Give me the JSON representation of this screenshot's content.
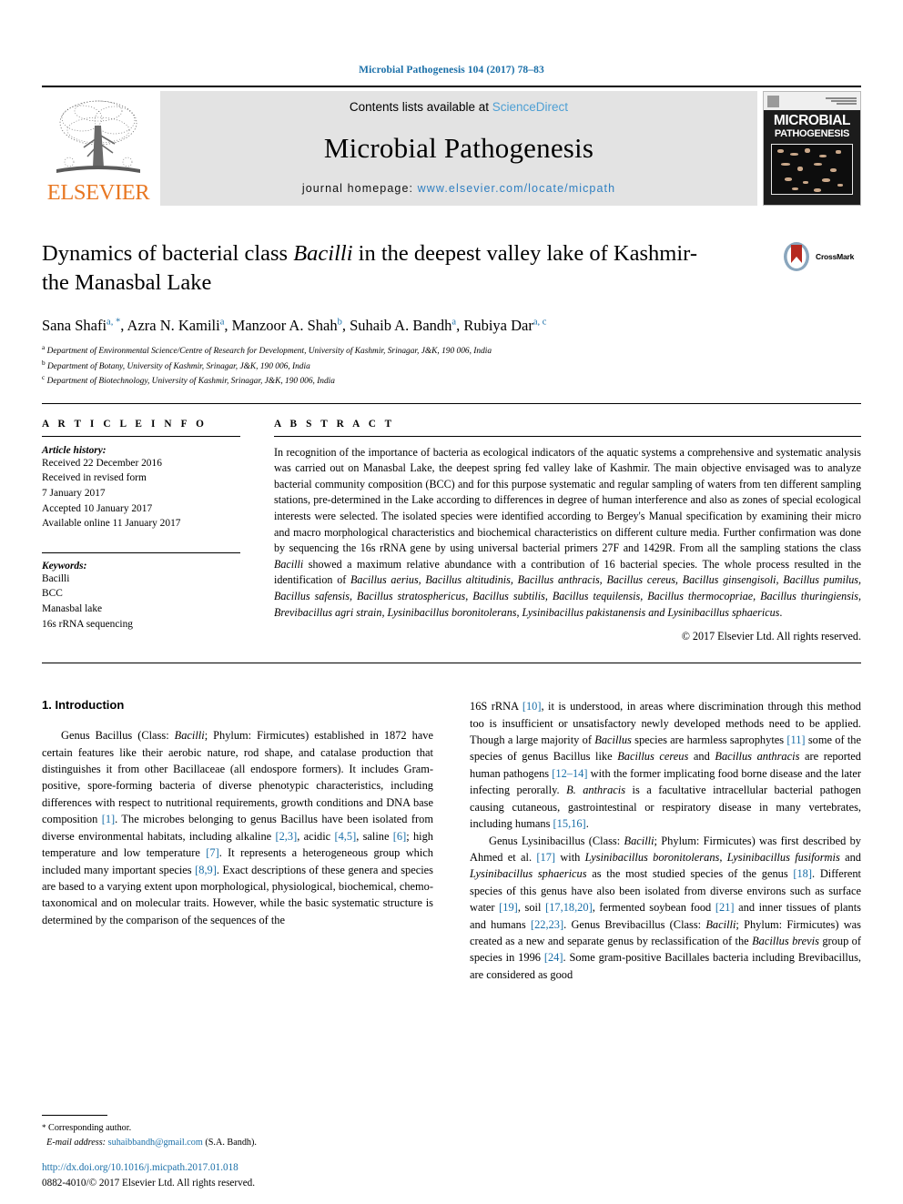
{
  "running_head": "Microbial Pathogenesis 104 (2017) 78–83",
  "masthead": {
    "publisher_name": "ELSEVIER",
    "contents_prefix": "Contents lists available at",
    "contents_link": "ScienceDirect",
    "journal_name": "Microbial Pathogenesis",
    "homepage_label": "journal homepage:",
    "homepage_url": "www.elsevier.com/locate/micpath",
    "cover": {
      "line1": "MICROBIAL",
      "line2": "PATHOGENESIS"
    }
  },
  "article": {
    "title_part1": "Dynamics of bacterial class ",
    "title_italic": "Bacilli",
    "title_part2": " in the deepest valley lake of Kashmir-the Manasbal Lake",
    "crossmark_label": "CrossMark",
    "authors": [
      {
        "name": "Sana Shafi",
        "sup": "a, *"
      },
      {
        "name": "Azra N. Kamili",
        "sup": "a"
      },
      {
        "name": "Manzoor A. Shah",
        "sup": "b"
      },
      {
        "name": "Suhaib A. Bandh",
        "sup": "a"
      },
      {
        "name": "Rubiya Dar",
        "sup": "a, c"
      }
    ],
    "affiliations": [
      {
        "mark": "a",
        "text": "Department of Environmental Science/Centre of Research for Development, University of Kashmir, Srinagar, J&K, 190 006, India"
      },
      {
        "mark": "b",
        "text": "Department of Botany, University of Kashmir, Srinagar, J&K, 190 006, India"
      },
      {
        "mark": "c",
        "text": "Department of Biotechnology, University of Kashmir, Srinagar, J&K, 190 006, India"
      }
    ]
  },
  "article_info": {
    "heading": "A R T I C L E   I N F O",
    "history_label": "Article history:",
    "history": [
      "Received 22 December 2016",
      "Received in revised form",
      "7 January 2017",
      "Accepted 10 January 2017",
      "Available online 11 January 2017"
    ],
    "keywords_label": "Keywords:",
    "keywords": [
      "Bacilli",
      "BCC",
      "Manasbal lake",
      "16s rRNA sequencing"
    ]
  },
  "abstract": {
    "heading": "A B S T R A C T",
    "copyright": "© 2017 Elsevier Ltd. All rights reserved.",
    "paragraph_1": "In recognition of the importance of bacteria as ecological indicators of the aquatic systems a comprehensive and systematic analysis was carried out on Manasbal Lake, the deepest spring fed valley lake of Kashmir. The main objective envisaged was to analyze bacterial community composition (BCC) and for this purpose systematic and regular sampling of waters from ten different sampling stations, pre-determined in the Lake according to differences in degree of human interference and also as zones of special ecological interests were selected. The isolated species were identified according to Bergey's Manual specification by examining their micro and macro morphological characteristics and biochemical characteristics on different culture media. Further confirmation was done by sequencing the 16s rRNA gene by using universal bacterial primers 27F and 1429R. From all the sampling stations the class ",
    "italic_1": "Bacilli",
    "paragraph_2": " showed a maximum relative abundance with a contribution of 16 bacterial species. The whole process resulted in the identification of ",
    "species_list": "Bacillus aerius, Bacillus altitudinis, Bacillus anthracis, Bacillus cereus, Bacillus ginsengisoli, Bacillus pumilus, Bacillus safensis, Bacillus stratosphericus, Bacillus subtilis, Bacillus tequilensis, Bacillus thermocopriae, Bacillus thuringiensis, Brevibacillus agri strain, Lysinibacillus boronitolerans, Lysinibacillus pakistanensis and Lysinibacillus sphaericus",
    "paragraph_3": "."
  },
  "intro": {
    "heading": "1. Introduction",
    "left_paragraph_parts": {
      "t1": "Genus Bacillus (Class: ",
      "i1": "Bacilli",
      "t2": "; Phylum: Firmicutes) established in 1872 have certain features like their aerobic nature, rod shape, and catalase production that distinguishes it from other Bacillaceae (all endospore formers). It includes Gram-positive, spore-forming bacteria of diverse phenotypic characteristics, including differences with respect to nutritional requirements, growth conditions and DNA base composition ",
      "r1": "[1]",
      "t3": ". The microbes belonging to genus Bacillus have been isolated from diverse environmental habitats, including alkaline ",
      "r2": "[2,3]",
      "t4": ", acidic ",
      "r3": "[4,5]",
      "t5": ", saline ",
      "r4": "[6]",
      "t6": "; high temperature and low temperature ",
      "r5": "[7]",
      "t7": ". It represents a heterogeneous group which included many important species ",
      "r6": "[8,9]",
      "t8": ". Exact descriptions of these genera and species are based to a varying extent upon morphological, physiological, biochemical, chemo-taxonomical and on molecular traits. However, while the basic systematic structure is determined by the comparison of the sequences of the"
    },
    "right_paragraph_parts": {
      "t1": "16S rRNA ",
      "r1": "[10]",
      "t2": ", it is understood, in areas where discrimination through this method too is insufficient or unsatisfactory newly developed methods need to be applied. Though a large majority of ",
      "i1": "Bacillus",
      "t3": " species are harmless saprophytes ",
      "r2": "[11]",
      "t4": " some of the species of genus Bacillus like ",
      "i2": "Bacillus cereus",
      "t5": " and ",
      "i3": "Bacillus anthracis",
      "t6": " are reported human pathogens ",
      "r3": "[12–14]",
      "t7": " with the former implicating food borne disease and the later infecting perorally. ",
      "i4": "B. anthracis",
      "t8": " is a facultative intracellular bacterial pathogen causing cutaneous, gastrointestinal or respiratory disease in many vertebrates, including humans ",
      "r4": "[15,16]",
      "t9": "."
    },
    "right_paragraph2_parts": {
      "t1": "Genus Lysinibacillus (Class: ",
      "i1": "Bacilli",
      "t2": "; Phylum: Firmicutes) was first described by Ahmed et al. ",
      "r1": "[17]",
      "t3": " with ",
      "i2": "Lysinibacillus boronitolerans, Lysinibacillus fusiformis",
      "t4": " and ",
      "i3": "Lysinibacillus sphaericus",
      "t5": " as the most studied species of the genus ",
      "r2": "[18]",
      "t6": ". Different species of this genus have also been isolated from diverse environs such as surface water ",
      "r3": "[19]",
      "t7": ", soil ",
      "r4": "[17,18,20]",
      "t8": ", fermented soybean food ",
      "r5": "[21]",
      "t9": " and inner tissues of plants and humans ",
      "r6": "[22,23]",
      "t10": ". Genus Brevibacillus (Class: ",
      "i4": "Bacilli",
      "t11": "; Phylum: Firmicutes) was created as a new and separate genus by reclassification of the ",
      "i5": "Bacillus brevis",
      "t12": " group of species in 1996 ",
      "r7": "[24]",
      "t13": ". Some gram-positive Bacillales bacteria including Brevibacillus, are considered as good"
    }
  },
  "footer": {
    "corresponding_star": "*",
    "corresponding_label": "Corresponding author.",
    "email_label": "E-mail address:",
    "email": "suhaibbandh@gmail.com",
    "email_suffix": "(S.A. Bandh).",
    "doi": "http://dx.doi.org/10.1016/j.micpath.2017.01.018",
    "issn_line": "0882-4010/© 2017 Elsevier Ltd. All rights reserved."
  },
  "colors": {
    "link": "#1a6fa8",
    "elsevier_orange": "#E87722",
    "band_gray": "#e3e3e3"
  }
}
